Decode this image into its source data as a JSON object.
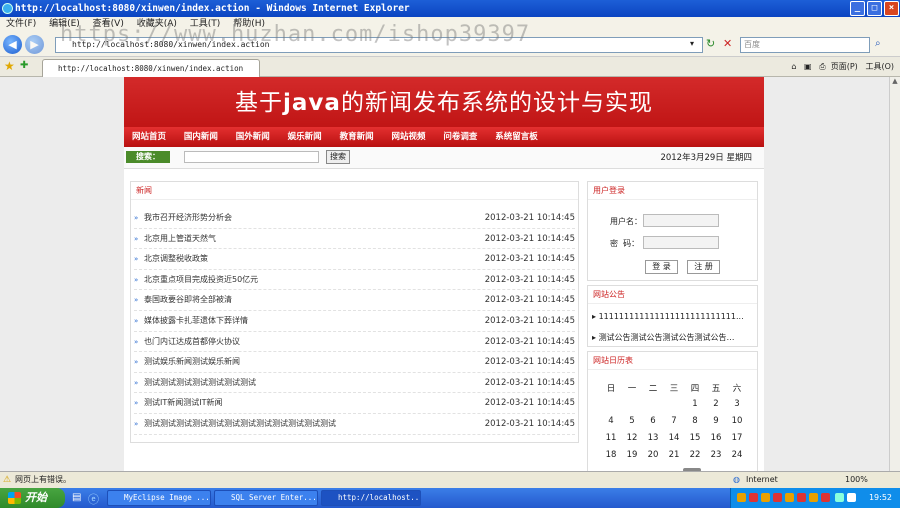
{
  "window": {
    "title": "http://localhost:8080/xinwen/index.action - Windows Internet Explorer"
  },
  "menu": [
    "文件(F)",
    "编辑(E)",
    "查看(V)",
    "收藏夹(A)",
    "工具(T)",
    "帮助(H)"
  ],
  "address": {
    "url": "http://localhost:8080/xinwen/index.action",
    "search_placeholder": "百度"
  },
  "tab": {
    "label": "http://localhost:8080/xinwen/index.action"
  },
  "commandbar": {
    "page": "页面(P)",
    "tools": "工具(O)"
  },
  "watermark": "https://www.huzhan.com/ishop39397",
  "site": {
    "banner_pre": "基于",
    "banner_bold": "java",
    "banner_post": "的新闻发布系统的设计与实现",
    "nav": [
      "网站首页",
      "国内新闻",
      "国外新闻",
      "娱乐新闻",
      "教育新闻",
      "网站视频",
      "问卷调查",
      "系统留言板"
    ],
    "search_label": "搜索：",
    "search_button": "搜索",
    "date": "2012年3月29日 星期四",
    "news_title": "新闻",
    "news": [
      {
        "title": "我市召开经济形势分析会",
        "date": "2012-03-21 10:14:45"
      },
      {
        "title": "北京用上管道天然气",
        "date": "2012-03-21 10:14:45"
      },
      {
        "title": "北京调整税收政策",
        "date": "2012-03-21 10:14:45"
      },
      {
        "title": "北京重点项目完成投资近50亿元",
        "date": "2012-03-21 10:14:45"
      },
      {
        "title": "泰国政要谷即将全部被清",
        "date": "2012-03-21 10:14:45"
      },
      {
        "title": "媒体披露卡扎菲遗体下葬详情",
        "date": "2012-03-21 10:14:45"
      },
      {
        "title": "也门内讧达成首都停火协议",
        "date": "2012-03-21 10:14:45"
      },
      {
        "title": "测试娱乐新闻测试娱乐新闻",
        "date": "2012-03-21 10:14:45"
      },
      {
        "title": "测试测试测试测试测试测试测试",
        "date": "2012-03-21 10:14:45"
      },
      {
        "title": "测试IT新闻测试IT新闻",
        "date": "2012-03-21 10:14:45"
      },
      {
        "title": "测试测试测试测试测试测试测试测试测试测试测试测试",
        "date": "2012-03-21 10:14:45"
      }
    ],
    "login": {
      "title": "用户登录",
      "username_label": "用户名：",
      "password_label": "密  码：",
      "login_button": "登 录",
      "register_button": "注 册"
    },
    "notice": {
      "title": "网站公告",
      "items": [
        "111111111111111111111111111...",
        "测试公告测试公告测试公告测试公告…"
      ]
    },
    "calendar": {
      "title": "网站日历表",
      "weekdays": [
        "日",
        "一",
        "二",
        "三",
        "四",
        "五",
        "六"
      ],
      "rows": [
        [
          "",
          "",
          "",
          "",
          "1",
          "2",
          "3"
        ],
        [
          "4",
          "5",
          "6",
          "7",
          "8",
          "9",
          "10"
        ],
        [
          "11",
          "12",
          "13",
          "14",
          "15",
          "16",
          "17"
        ],
        [
          "18",
          "19",
          "20",
          "21",
          "22",
          "23",
          "24"
        ]
      ]
    }
  },
  "status": {
    "left": "网页上有错误。",
    "zone": "Internet",
    "zoom": "100%"
  },
  "taskbar": {
    "start": "开始",
    "tasks": [
      "MyEclipse Image ...",
      "SQL Server Enter...",
      "http://localhost..."
    ],
    "clock": "19:52"
  }
}
